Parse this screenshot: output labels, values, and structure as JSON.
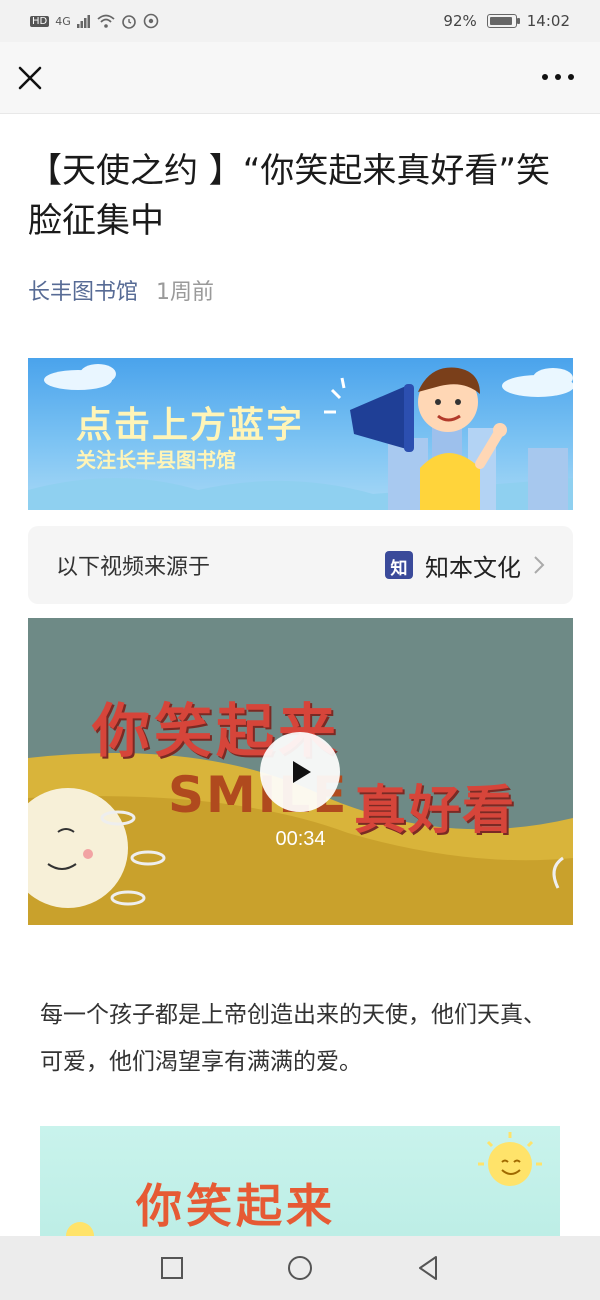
{
  "status_bar": {
    "left_label": "HD",
    "network": "4G",
    "battery_percent_label": "92%",
    "battery_level": 0.92,
    "time": "14:02"
  },
  "nav": {
    "close_icon": "close-icon",
    "more_icon": "more-icon"
  },
  "article": {
    "title": "【天使之约 】“你笑起来真好看”笑脸征集中",
    "author": "长丰图书馆",
    "time": "1周前"
  },
  "banner": {
    "line1": "点击上方蓝字",
    "line2": "关注长丰县图书馆"
  },
  "source": {
    "label": "以下视频来源于",
    "name": "知本文化",
    "logo_char": "知"
  },
  "video": {
    "text1": "你笑起来",
    "text2": "SMILE",
    "text3": "真好看",
    "duration": "00:34"
  },
  "paragraph": "每一个孩子都是上帝创造出来的天使，他们天真、可爱，他们渴望享有满满的爱。",
  "image2": {
    "text": "你笑起来"
  },
  "bottom_nav": {
    "square_icon": "recent-apps-icon",
    "circle_icon": "home-icon",
    "triangle_icon": "back-icon"
  },
  "colors": {
    "author_link": "#576b95",
    "banner_blue": "#4aa3ec",
    "video_red": "#d6453a"
  }
}
